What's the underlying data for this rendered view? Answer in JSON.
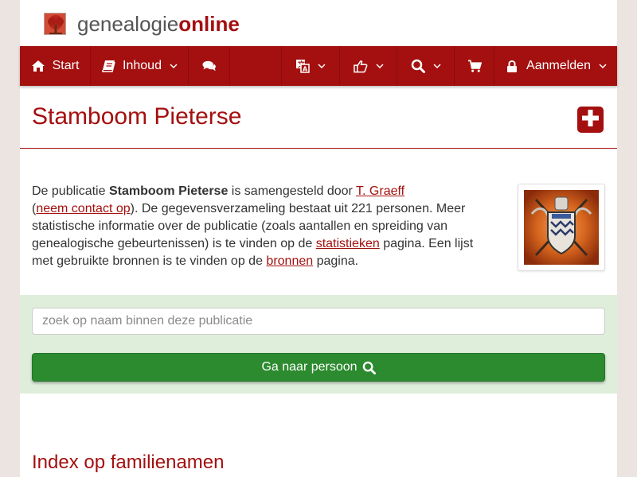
{
  "brand": {
    "name_regular": "genealogie",
    "name_bold": "online",
    "logo_icon": "tree-logo-icon"
  },
  "nav": {
    "start": {
      "label": "Start",
      "icon": "home-icon"
    },
    "inhoud": {
      "label": "Inhoud",
      "icon": "book-icon"
    },
    "chat": {
      "icon": "comments-icon"
    },
    "language": {
      "icon": "translate-icon"
    },
    "share": {
      "icon": "thumbs-up-icon"
    },
    "search": {
      "icon": "search-icon"
    },
    "cart": {
      "icon": "cart-icon"
    },
    "login": {
      "label": "Aanmelden",
      "icon": "lock-icon"
    }
  },
  "title": {
    "text": "Stamboom Pieterse",
    "add_icon": "plus-square-icon"
  },
  "intro": {
    "p1": "De publicatie ",
    "pub_name": "Stamboom Pieterse",
    "p2": " is samengesteld door ",
    "author": "T. Graeff",
    "p3": "\n(",
    "contact": "neem contact op",
    "p4": "). De gegevensverzameling bestaat uit 221 personen. Meer statistische informatie over de publicatie (zoals aantallen en spreiding van genealogische gebeurtenissen) is te vinden op de ",
    "stats_link": "statistieken",
    "p5": " pagina. Een lijst met gebruikte bronnen is te vinden op de ",
    "sources_link": "bronnen",
    "p6": " pagina."
  },
  "search": {
    "placeholder": "zoek op naam binnen deze publicatie",
    "button_label": "Ga naar persoon",
    "button_icon": "search-icon"
  },
  "index": {
    "title": "Index op familienamen"
  },
  "colors": {
    "brand_red": "#a3100f",
    "go_green": "#2c8a2f",
    "search_band": "#dfeedb",
    "background": "#ece4e0"
  }
}
